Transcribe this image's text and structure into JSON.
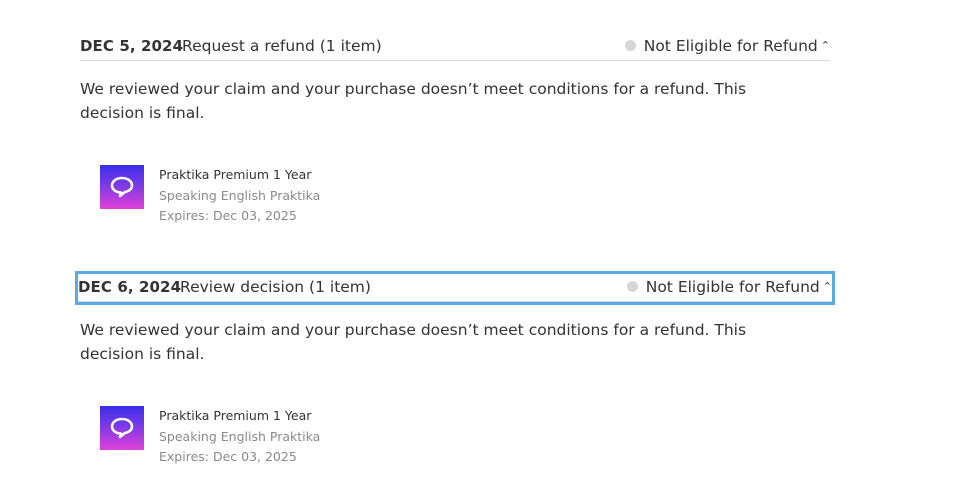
{
  "claims": [
    {
      "date": "DEC 5, 2024",
      "title": "Request a refund (1 item)",
      "status": "Not Eligible for Refund",
      "message": "We reviewed your claim and your purchase doesn’t meet conditions for a refund. This decision is final.",
      "item": {
        "name": "Praktika Premium 1 Year",
        "developer": "Speaking English Praktika",
        "expires": "Expires: Dec 03, 2025",
        "icon": "speech-bubble-icon"
      }
    },
    {
      "date": "DEC 6, 2024",
      "title": "Review decision (1 item)",
      "status": "Not Eligible for Refund",
      "message": "We reviewed your claim and your purchase doesn’t meet conditions for a refund. This decision is final.",
      "item": {
        "name": "Praktika Premium 1 Year",
        "developer": "Speaking English Praktika",
        "expires": "Expires: Dec 03, 2025",
        "icon": "speech-bubble-icon"
      }
    }
  ],
  "colors": {
    "status_dot": "#d6d6d6",
    "focus_ring": "#5aa9e6",
    "icon_gradient_top": "#3a2ee8",
    "icon_gradient_bottom": "#e040d8"
  }
}
